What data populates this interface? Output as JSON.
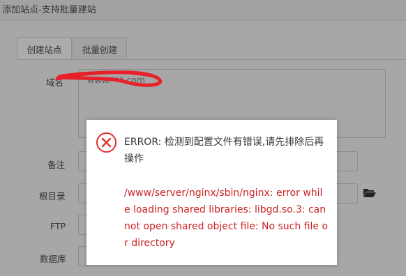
{
  "dialog": {
    "title": "添加站点-支持批量建站"
  },
  "tabs": [
    {
      "label": "创建站点",
      "active": true
    },
    {
      "label": "批量创建",
      "active": false
    }
  ],
  "form": {
    "domain_label": "域名",
    "domain_value": "www.***.com",
    "remark_label": "备注",
    "root_label": "根目录",
    "ftp_label": "FTP",
    "database_label": "数据库"
  },
  "icons": {
    "folder": "folder-open-icon",
    "error": "error-circle-x-icon"
  },
  "error_modal": {
    "title": "ERROR: 检测到配置文件有错误,请先排除后再操作",
    "detail": "/www/server/nginx/sbin/nginx: error while loading shared libraries: libgd.so.3: cannot open shared object file: No such file or directory"
  },
  "colors": {
    "error_red": "#cc2222",
    "overlay_gray": "#a7a7a7",
    "scribble_red": "#e8202a"
  }
}
